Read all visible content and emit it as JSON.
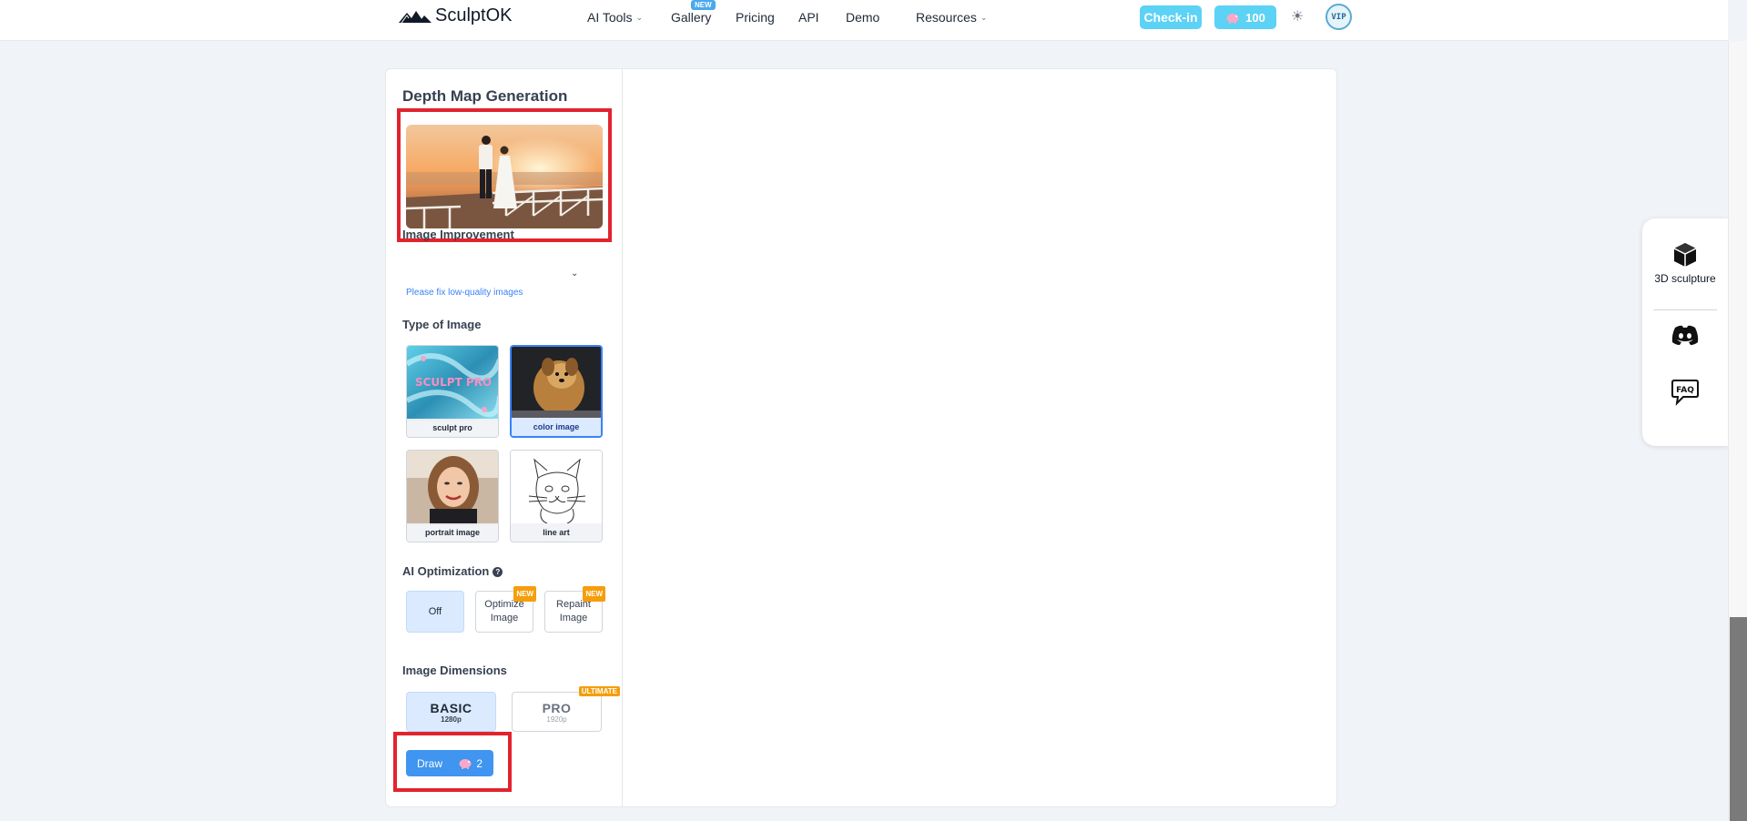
{
  "nav": {
    "logo_text": "SculptOK",
    "items": [
      {
        "label": "AI Tools",
        "has_dropdown": true
      },
      {
        "label": "Gallery",
        "badge": "NEW"
      },
      {
        "label": "Pricing"
      },
      {
        "label": "API"
      },
      {
        "label": "Demo"
      },
      {
        "label": "Resources",
        "has_dropdown": true
      }
    ],
    "checkin_label": "Check-in",
    "credits": "100",
    "avatar_text": "VIP"
  },
  "panel": {
    "title": "Depth Map Generation",
    "image_improvement": {
      "label": "Image Improvement",
      "hint": "Please fix low-quality images"
    },
    "type_of_image": {
      "label": "Type of Image",
      "options": [
        {
          "label": "sculpt pro",
          "overlay_text": "SCULPT PRO",
          "selected": false
        },
        {
          "label": "color image",
          "selected": true
        },
        {
          "label": "portrait image",
          "selected": false
        },
        {
          "label": "line art",
          "selected": false
        }
      ]
    },
    "ai_optimization": {
      "label": "AI Optimization",
      "help_icon": "?",
      "options": [
        {
          "label": "Off",
          "active": true
        },
        {
          "label_line1": "Optimize",
          "label_line2": "Image",
          "badge": "NEW"
        },
        {
          "label_line1": "Repaint",
          "label_line2": "Image",
          "badge": "NEW"
        }
      ]
    },
    "image_dimensions": {
      "label": "Image Dimensions",
      "options": [
        {
          "label": "BASIC",
          "sub": "1280p",
          "active": true
        },
        {
          "label": "PRO",
          "sub": "1920p",
          "badge": "ULTIMATE"
        }
      ]
    },
    "draw": {
      "label": "Draw",
      "cost": "2"
    }
  },
  "side": {
    "sculpture_label": "3D sculpture",
    "faq_text": "FAQ"
  },
  "colors": {
    "accent": "#3f95ef",
    "highlight": "#e2232e",
    "badge_orange": "#f59e0b",
    "cyan": "#5cd2f5"
  }
}
